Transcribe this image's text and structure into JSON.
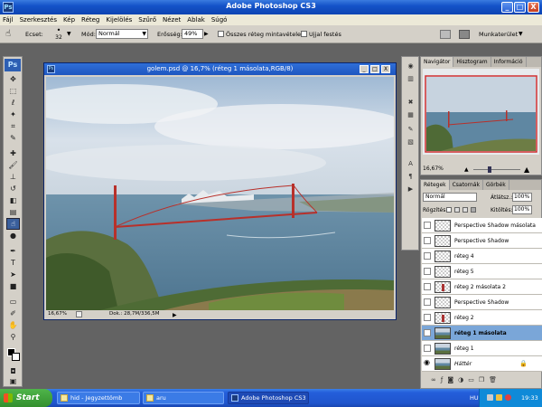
{
  "app": {
    "title": "Adobe Photoshop CS3",
    "icon_text": "Ps",
    "icon": "photoshop-app-icon"
  },
  "window_controls": {
    "minimize": "_",
    "maximize": "□",
    "close": "X"
  },
  "menu": [
    "Fájl",
    "Szerkesztés",
    "Kép",
    "Réteg",
    "Kijelölés",
    "Szűrő",
    "Nézet",
    "Ablak",
    "Súgó"
  ],
  "options": {
    "brush_label": "Ecset:",
    "brush_size": "32",
    "mode_label": "Mód:",
    "mode_value": "Normál",
    "strength_label": "Erősség:",
    "strength_value": "49%",
    "all_layers_label": "Összes réteg mintavétele",
    "finger_paint_label": "Ujjal festés",
    "workspace_label": "Munkaterület"
  },
  "document": {
    "title": "golem.psd @ 16,7% (réteg 1 másolata,RGB/8)",
    "zoom": "16,67%",
    "doc_info": "Dok.: 28,7M/336,5M"
  },
  "navigator": {
    "tabs": [
      "Navigátor",
      "Hisztogram",
      "Információ"
    ],
    "zoom": "16,67%"
  },
  "layers": {
    "tabs": [
      "Rétegek",
      "Csatornák",
      "Görbék"
    ],
    "blend_mode": "Normál",
    "opacity_label": "Átlátsz.:",
    "opacity_value": "100%",
    "lock_label": "Rögzítés:",
    "fill_label": "Kitöltés:",
    "fill_value": "100%",
    "items": [
      {
        "name": "Perspective Shadow másolata",
        "selected": false
      },
      {
        "name": "Perspective Shadow",
        "selected": false
      },
      {
        "name": "réteg 4",
        "selected": false
      },
      {
        "name": "réteg 5",
        "selected": false
      },
      {
        "name": "réteg 2 másolata 2",
        "selected": false
      },
      {
        "name": "Perspective Shadow",
        "selected": false
      },
      {
        "name": "réteg 2",
        "selected": false
      },
      {
        "name": "réteg 1 másolata",
        "selected": true
      },
      {
        "name": "réteg 1",
        "selected": false
      },
      {
        "name": "Háttér",
        "selected": false
      }
    ]
  },
  "taskbar": {
    "start_label": "Start",
    "tasks": [
      {
        "label": "hid - Jegyzettömb",
        "active": false
      },
      {
        "label": "aru",
        "active": false
      },
      {
        "label": "Adobe Photoshop CS3",
        "active": true
      }
    ],
    "language": "HU",
    "time": "19:33"
  },
  "colors": {
    "accent": "#245edb",
    "selected_layer": "#7aa6d8",
    "start_green": "#3c9a37"
  }
}
